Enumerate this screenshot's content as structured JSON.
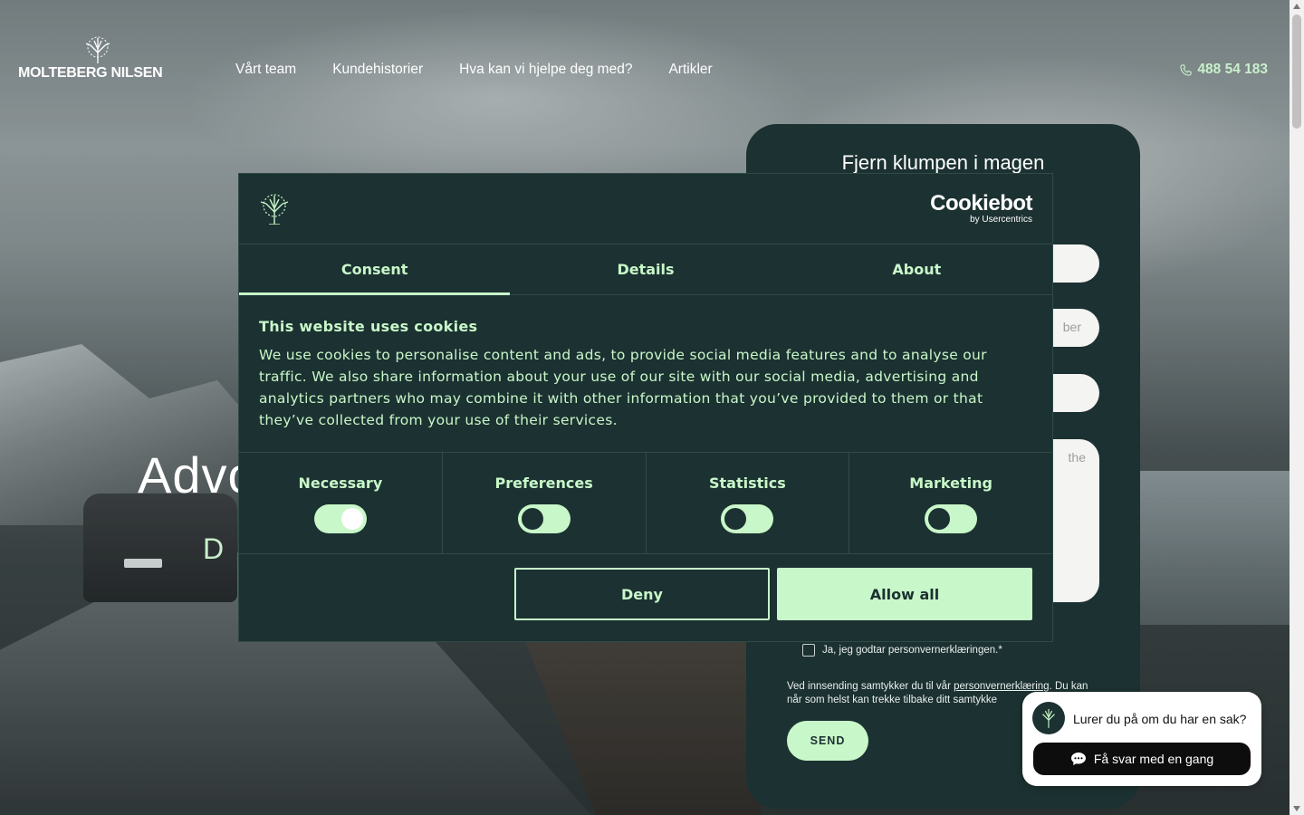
{
  "header": {
    "logo_text": "MOLTEBERG NILSEN",
    "nav": [
      "Vårt team",
      "Kundehistorier",
      "Hva kan vi hjelpe deg med?",
      "Artikler"
    ],
    "phone": "488 54 183"
  },
  "hero": {
    "title_partial": "Advo",
    "subtitle_partial": "D"
  },
  "contact_form": {
    "title": "Fjern klumpen i magen",
    "phone_placeholder_partial": "ber",
    "message_placeholder_partial": "the",
    "consent_label": "Ja, jeg godtar personvernerklæringen.*",
    "note_before_link": "Ved innsending samtykker du til vår ",
    "note_link": "personvernerklæring",
    "note_after_link": ". Du kan når som helst kan trekke tilbake ditt samtykke",
    "send_label": "SEND"
  },
  "cookie_dialog": {
    "brand": "Cookiebot",
    "brand_sub": "by Usercentrics",
    "tabs": [
      "Consent",
      "Details",
      "About"
    ],
    "active_tab": "Consent",
    "heading": "This website uses cookies",
    "body": "We use cookies to personalise content and ads, to provide social media features and to analyse our traffic. We also share information about your use of our site with our social media, advertising and analytics partners who may combine it with other information that you’ve provided to them or that they’ve collected from your use of their services.",
    "categories": [
      {
        "label": "Necessary",
        "on": true
      },
      {
        "label": "Preferences",
        "on": false
      },
      {
        "label": "Statistics",
        "on": false
      },
      {
        "label": "Marketing",
        "on": false
      }
    ],
    "deny_label": "Deny",
    "allow_label": "Allow all"
  },
  "chat": {
    "question": "Lurer du på om du har en sak?",
    "cta": "Få svar med en gang"
  },
  "colors": {
    "dark_green": "#1c3131",
    "mint": "#c8f7c9"
  }
}
